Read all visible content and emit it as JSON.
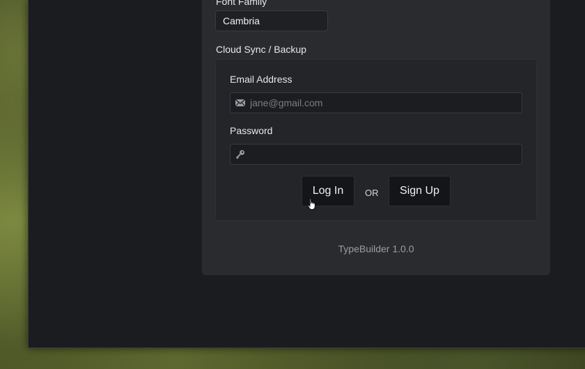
{
  "settings": {
    "font_family_label": "Font Family",
    "font_family_value": "Cambria",
    "cloud_sync_label": "Cloud Sync / Backup"
  },
  "login": {
    "email_label": "Email Address",
    "email_placeholder": "jane@gmail.com",
    "email_icon": "envelope-icon",
    "password_label": "Password",
    "password_placeholder": "",
    "password_icon": "key-icon",
    "login_button": "Log In",
    "or_text": "OR",
    "signup_button": "Sign Up"
  },
  "footer": {
    "version": "TypeBuilder 1.0.0"
  },
  "colors": {
    "panel_bg": "#2a2b2f",
    "window_bg": "#1b1c20",
    "button_bg": "#141518"
  }
}
